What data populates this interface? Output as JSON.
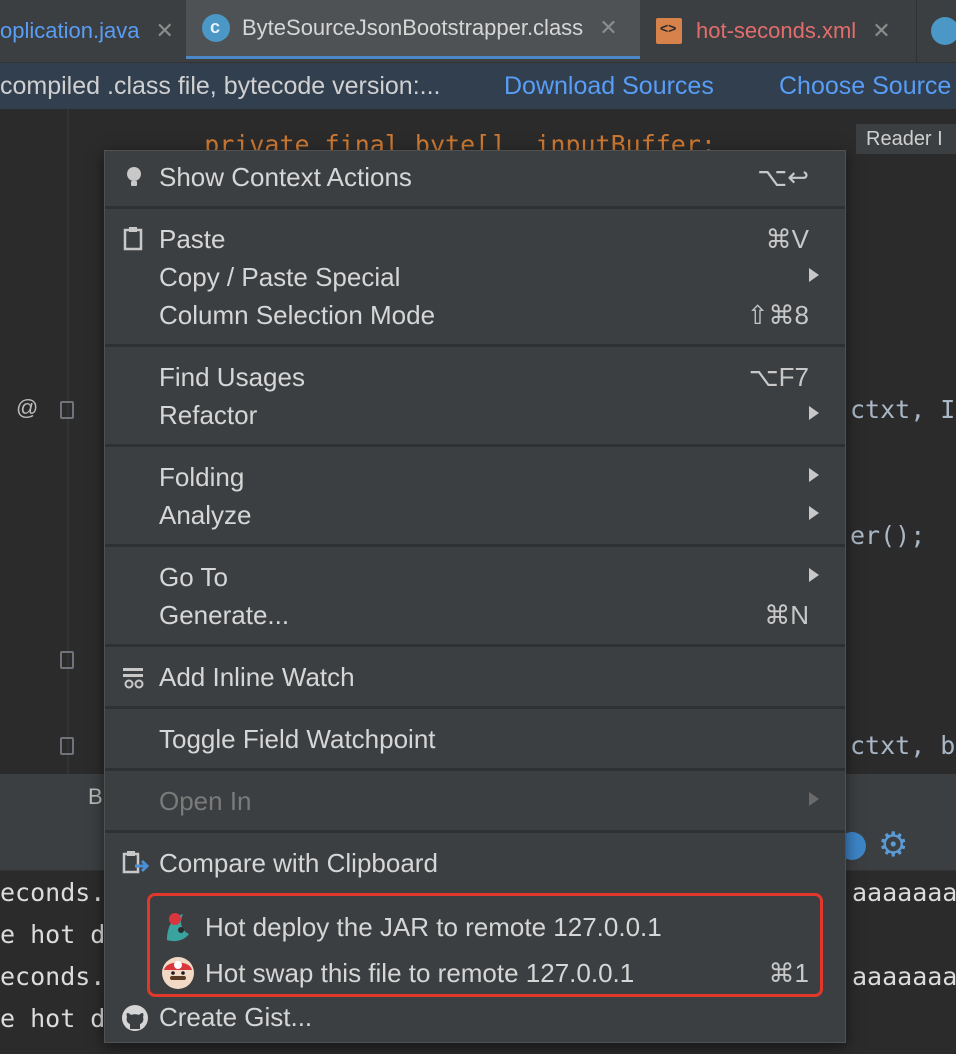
{
  "tabs": [
    {
      "label": "oplication.java",
      "type": "java"
    },
    {
      "label": "ByteSourceJsonBootstrapper.class",
      "type": "class",
      "active": true
    },
    {
      "label": "hot-seconds.xml",
      "type": "xml"
    }
  ],
  "banner": {
    "text": "compiled .class file, bytecode version:...",
    "download_sources": "Download Sources",
    "choose_sources": "Choose Source"
  },
  "editor": {
    "lines": [
      {
        "text": "private final byte[] _inputBuffer;"
      },
      {
        "text": "ctxt, I"
      },
      {
        "text": "er();"
      },
      {
        "text": "ctxt, b"
      }
    ],
    "annotation_glyph": "@",
    "reader_mode": "Reader I"
  },
  "tool_window": {
    "tab_partial": "B"
  },
  "console": {
    "lines": [
      {
        "left": "econds.x",
        "right": "aaaaaaa"
      },
      {
        "left": "e hot de",
        "right": ""
      },
      {
        "left": "econds.x",
        "right": "aaaaaaa"
      },
      {
        "left": "e hot de",
        "right": ""
      }
    ]
  },
  "context_menu": {
    "groups": [
      [
        {
          "label": "Show Context Actions",
          "shortcut": "⌥↩",
          "icon": "lightbulb-icon"
        }
      ],
      [
        {
          "label": "Paste",
          "shortcut": "⌘V",
          "icon": "clipboard-icon"
        },
        {
          "label": "Copy / Paste Special",
          "submenu": true
        },
        {
          "label": "Column Selection Mode",
          "shortcut": "⇧⌘8"
        }
      ],
      [
        {
          "label": "Find Usages",
          "shortcut": "⌥F7"
        },
        {
          "label": "Refactor",
          "submenu": true
        }
      ],
      [
        {
          "label": "Folding",
          "submenu": true
        },
        {
          "label": "Analyze",
          "submenu": true
        }
      ],
      [
        {
          "label": "Go To",
          "submenu": true
        },
        {
          "label": "Generate...",
          "shortcut": "⌘N"
        }
      ],
      [
        {
          "label": "Add Inline Watch",
          "icon": "inline-watch-icon"
        }
      ],
      [
        {
          "label": "Toggle Field Watchpoint"
        }
      ],
      [
        {
          "label": "Open In",
          "submenu": true,
          "disabled": true
        }
      ],
      [
        {
          "label": "Compare with Clipboard",
          "icon": "compare-clipboard-icon"
        }
      ],
      [
        {
          "label": "Hot deploy the JAR to remote 127.0.0.1",
          "icon": "hotdeploy-icon"
        },
        {
          "label": "Hot swap this file to remote 127.0.0.1",
          "shortcut": "⌘1",
          "icon": "mario-icon"
        },
        {
          "label": "Create Gist...",
          "icon": "github-icon"
        }
      ]
    ]
  },
  "colors": {
    "highlight_box": "#e2382b",
    "link": "#589df6",
    "menu_bg": "#3c3f41",
    "editor_bg": "#2b2b2b"
  }
}
